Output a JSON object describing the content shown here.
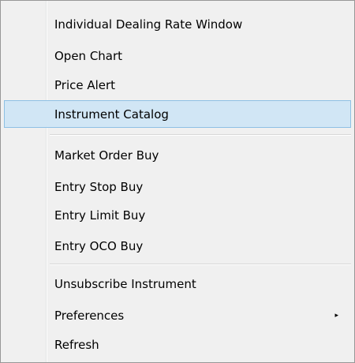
{
  "menu": {
    "groups": [
      {
        "items": [
          {
            "label": "Individual Dealing Rate Window"
          },
          {
            "label": "Open Chart"
          },
          {
            "label": "Price Alert"
          },
          {
            "label": "Instrument Catalog",
            "highlighted": true
          }
        ]
      },
      {
        "items": [
          {
            "label": "Market Order Buy"
          },
          {
            "label": "Entry Stop Buy"
          },
          {
            "label": "Entry Limit Buy"
          },
          {
            "label": "Entry OCO Buy"
          }
        ]
      },
      {
        "items": [
          {
            "label": "Unsubscribe Instrument"
          },
          {
            "label": "Preferences",
            "submenu_arrow": "▸"
          },
          {
            "label": "Refresh"
          }
        ]
      }
    ]
  },
  "colors": {
    "menu_background": "#f0f0f0",
    "highlight_background": "#d1e6f5",
    "highlight_border": "#8ec0e4",
    "text": "#000000"
  },
  "icons": {
    "submenu": "chevron-right-icon"
  }
}
